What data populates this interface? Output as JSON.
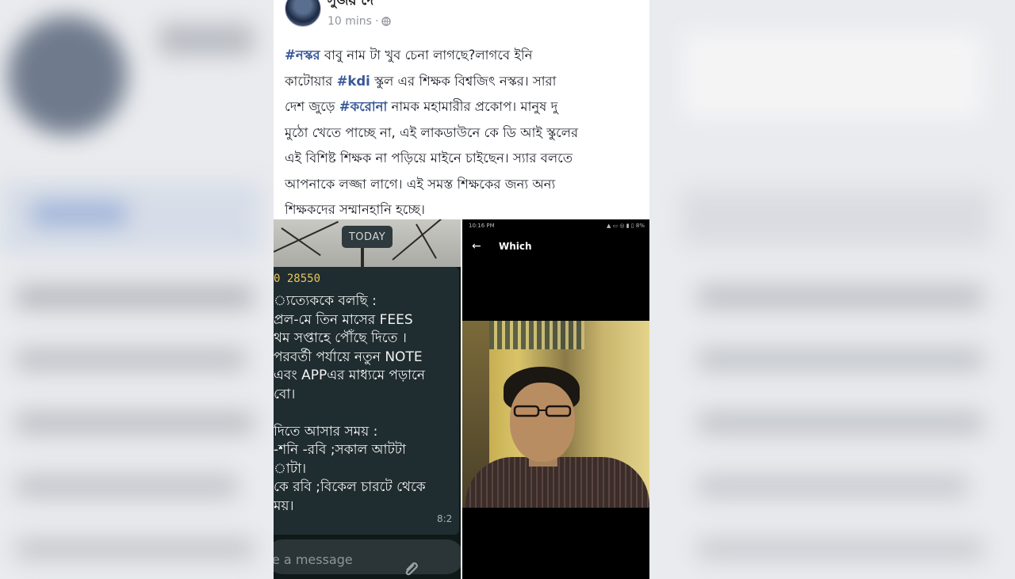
{
  "post": {
    "author": "সুজয় দে",
    "time": "10 mins",
    "separator": "·",
    "privacy_icon": "globe-icon",
    "text_lines": [
      [
        {
          "t": "#নস্কর",
          "tag": true
        },
        {
          "t": " বাবু নাম টা খুব চেনা লাগছে?লাগবে ইনি",
          "tag": false
        }
      ],
      [
        {
          "t": "কাটোয়ার ",
          "tag": false
        },
        {
          "t": "#kdi",
          "tag": true
        },
        {
          "t": " স্কুল এর শিক্ষক বিশ্বজিৎ নস্কর।  সারা",
          "tag": false
        }
      ],
      [
        {
          "t": "দেশ জুড়ে   ",
          "tag": false
        },
        {
          "t": "#করোনা",
          "tag": true
        },
        {
          "t": " নামক মহামারীর প্রকোপ। মানুষ দু",
          "tag": false
        }
      ],
      [
        {
          "t": "মুঠো খেতে পাচ্ছে না, এই  লাকডাউনে কে ডি আই স্কুলের",
          "tag": false
        }
      ],
      [
        {
          "t": "এই বিশিষ্ট শিক্ষক না পড়িয়ে মাইনে চাইছেন। স্যার বলতে",
          "tag": false
        }
      ],
      [
        {
          "t": "আপনাকে লজ্জা লাগে। এই সমস্ত শিক্ষকের জন্য অন্য",
          "tag": false
        }
      ],
      [
        {
          "t": "শিক্ষকদের সম্মানহানি হচ্ছে।",
          "tag": false
        }
      ]
    ]
  },
  "left_screenshot": {
    "date_chip": "TODAY",
    "phone_fragment": "0 28550",
    "message_lines": [
      "্যত্যেককে বলছি :",
      "প্রল-মে তিন মাসের FEES",
      "থম সপ্তাহে পৌঁছে দিতে ।",
      " পরবর্তী পর্যায়ে  নতুন NOTE",
      "এবং APPএর মাধ্যমে পড়ানে",
      "বো।",
      "",
      " দিতে আসার সময় :",
      " -শনি -রবি ;সকাল আটটা",
      "াটা।",
      "কে রবি ;বিকেল চারটে থেকে",
      "ময়।"
    ],
    "time": "8:2",
    "input_placeholder": "e a message",
    "attach_icon": "paperclip-icon"
  },
  "right_screenshot": {
    "status_time": "10:16 PM",
    "status_right": "▲ ▭ ◎ ▮ ▯ 8%",
    "back_icon": "back-arrow-icon",
    "back_glyph": "←",
    "title": "Which"
  }
}
